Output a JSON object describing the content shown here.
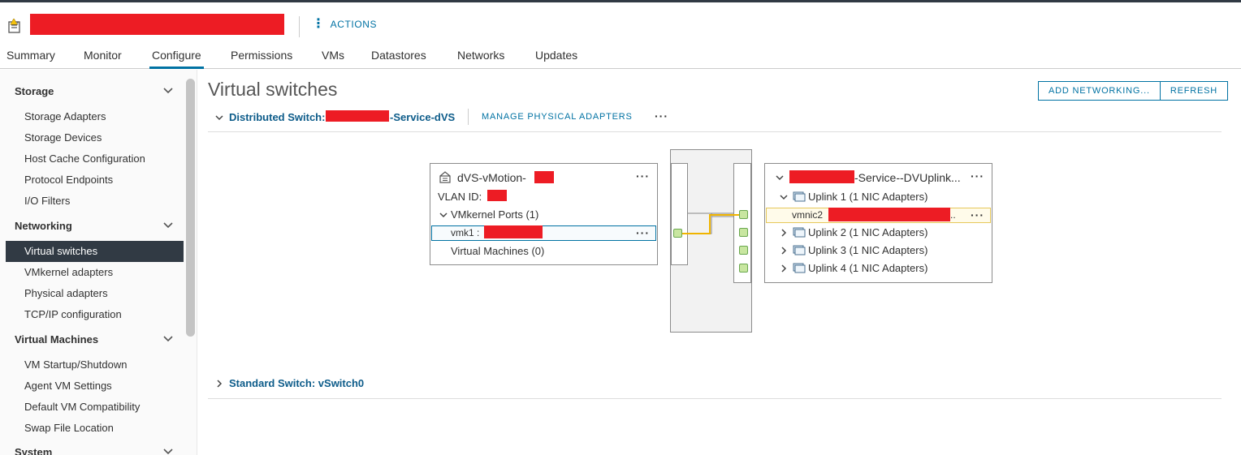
{
  "header": {
    "actions_label": "ACTIONS"
  },
  "tabs": [
    {
      "label": "Summary"
    },
    {
      "label": "Monitor"
    },
    {
      "label": "Configure"
    },
    {
      "label": "Permissions"
    },
    {
      "label": "VMs"
    },
    {
      "label": "Datastores"
    },
    {
      "label": "Networks"
    },
    {
      "label": "Updates"
    }
  ],
  "sidebar": {
    "groups": [
      {
        "label": "Storage",
        "items": [
          "Storage Adapters",
          "Storage Devices",
          "Host Cache Configuration",
          "Protocol Endpoints",
          "I/O Filters"
        ]
      },
      {
        "label": "Networking",
        "items": [
          "Virtual switches",
          "VMkernel adapters",
          "Physical adapters",
          "TCP/IP configuration"
        ]
      },
      {
        "label": "Virtual Machines",
        "items": [
          "VM Startup/Shutdown",
          "Agent VM Settings",
          "Default VM Compatibility",
          "Swap File Location"
        ]
      },
      {
        "label": "System",
        "items": []
      }
    ],
    "selected": "Virtual switches"
  },
  "main": {
    "title": "Virtual switches",
    "add_networking_label": "ADD NETWORKING...",
    "refresh_label": "REFRESH",
    "distributed": {
      "prefix": "Distributed Switch:",
      "suffix": "-Service-dVS",
      "manage_label": "MANAGE PHYSICAL ADAPTERS",
      "more_label": "···"
    },
    "portgroup": {
      "name": "dVS-vMotion-",
      "vlan_label": "VLAN ID:",
      "vmkernel_label": "VMkernel Ports (1)",
      "vmk_label": "vmk1 : ",
      "vm_label": "Virtual Machines (0)",
      "more_label": "···"
    },
    "uplinks": {
      "name": "-Service--DVUplink...",
      "more_label": "···",
      "items": [
        "Uplink 1 (1 NIC Adapters)",
        "Uplink 2 (1 NIC Adapters)",
        "Uplink 3 (1 NIC Adapters)",
        "Uplink 4 (1 NIC Adapters)"
      ],
      "vmnic_label": "vmnic2",
      "vmnic_trail": "..",
      "vmnic_more": "···"
    },
    "standard": {
      "label": "Standard Switch: vSwitch0"
    }
  },
  "colors": {
    "accent": "#0072a3",
    "selected_bg": "#313a44",
    "redaction": "#ed1c24",
    "link_line": "#f0b400"
  }
}
